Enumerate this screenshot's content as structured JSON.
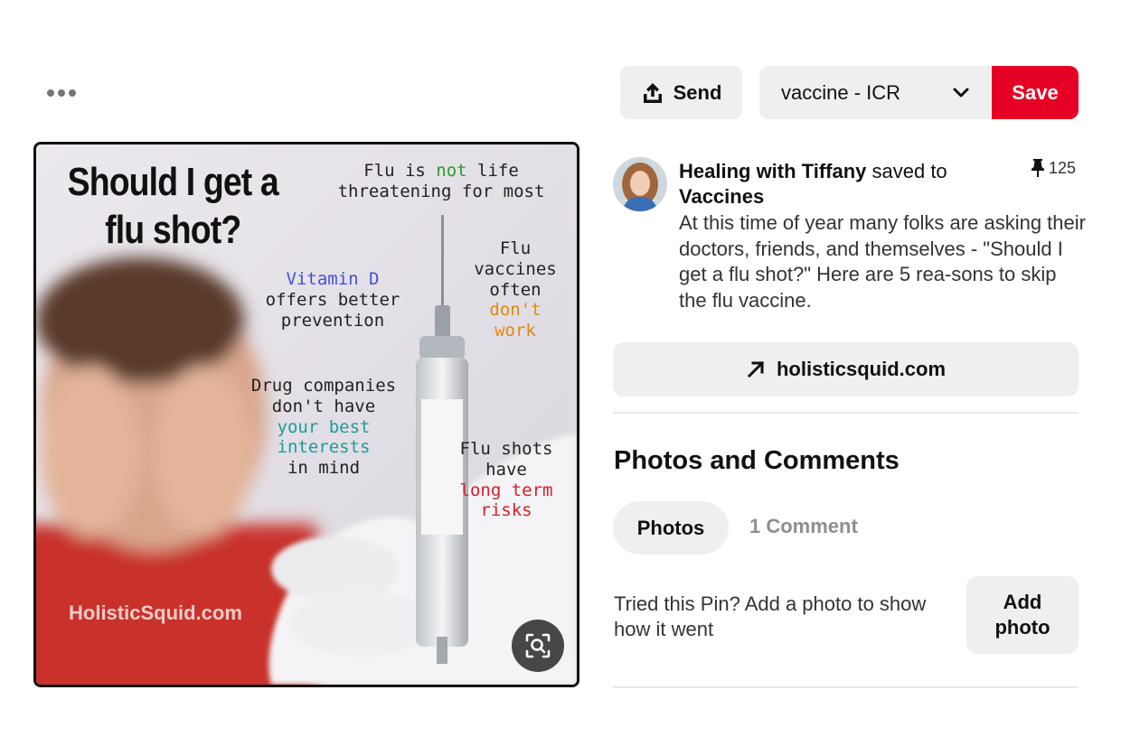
{
  "toolbar": {
    "more_icon": "more-horizontal-icon",
    "send_label": "Send",
    "send_icon": "share-upload-icon",
    "board_value": "vaccine - ICR",
    "board_icon": "chevron-down-icon",
    "save_label": "Save",
    "save_color": "#e60023"
  },
  "pin_image": {
    "title": "Should I get a flu shot?",
    "flu_line1_pre": "Flu is ",
    "flu_line1_emph": "not",
    "flu_line1_post": " life",
    "flu_line2": "threatening for most",
    "vitamin_d": "Vitamin D",
    "vitamin_line2": "offers better",
    "vitamin_line3": "prevention",
    "vacc_line1": "Flu",
    "vacc_line2": "vaccines",
    "vacc_line3": "often",
    "vacc_line4": "don't",
    "vacc_line5": "work",
    "drug_line1": "Drug companies",
    "drug_line2": "don't have",
    "drug_line3": "your best",
    "drug_line4": "interests",
    "drug_line5": "in mind",
    "shots_line1": "Flu shots",
    "shots_line2": "have",
    "shots_line3": "long term",
    "shots_line4": "risks",
    "watermark": "HolisticSquid.com",
    "lens_icon": "visual-search-icon"
  },
  "pin_info": {
    "saver_name": "Healing with Tiffany",
    "saved_to_text": " saved to ",
    "board_name": "Vaccines",
    "pin_count": "125",
    "pin_icon": "pushpin-icon",
    "description": "At this time of year many folks are asking their doctors, friends, and themselves - \"Should I get a flu shot?\" Here are 5 rea-sons to skip the flu vaccine.",
    "link_label": "holisticsquid.com",
    "link_icon": "arrow-up-right-icon"
  },
  "comments": {
    "section_title": "Photos and Comments",
    "tab_photos": "Photos",
    "tab_comments": "1 Comment",
    "tried_text": "Tried this Pin? Add a photo to show how it went",
    "add_photo_label": "Add photo"
  }
}
